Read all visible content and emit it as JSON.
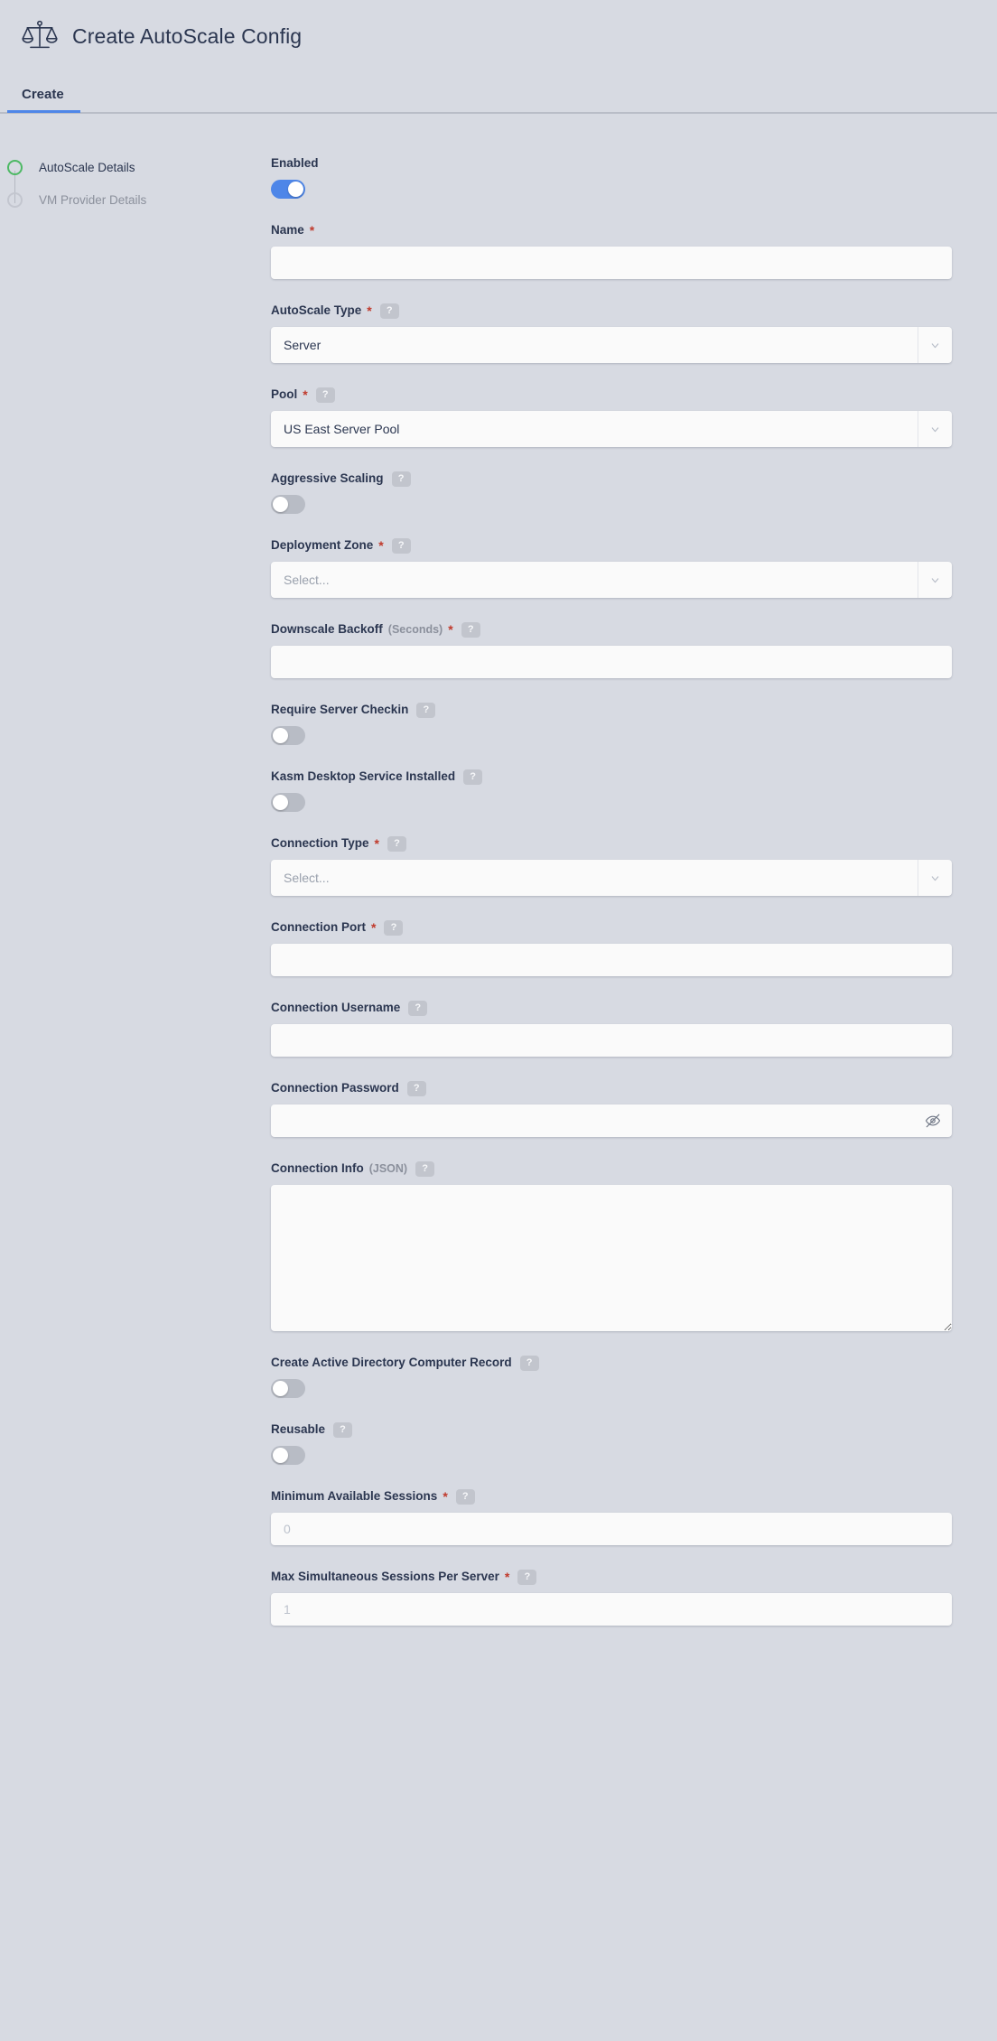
{
  "header": {
    "title": "Create AutoScale Config",
    "icon": "scale-balance-icon"
  },
  "tabs": [
    {
      "label": "Create",
      "active": true
    }
  ],
  "steps": [
    {
      "label": "AutoScale Details",
      "state": "active"
    },
    {
      "label": "VM Provider Details",
      "state": "pending"
    }
  ],
  "colors": {
    "page_background": "#d7dae2",
    "accent_blue": "#4e86e8",
    "step_active_green": "#4eb965",
    "label_text": "#2b3650",
    "required_red": "#c0392b",
    "help_badge": "#c2c5cd",
    "input_background": "#fafafa"
  },
  "fields": {
    "enabled": {
      "label": "Enabled",
      "type": "toggle",
      "value": true
    },
    "name": {
      "label": "Name",
      "required": true,
      "type": "text",
      "value": "",
      "placeholder": ""
    },
    "autoscale_type": {
      "label": "AutoScale Type",
      "required": true,
      "help": "?",
      "type": "select",
      "value": "Server"
    },
    "pool": {
      "label": "Pool",
      "required": true,
      "help": "?",
      "type": "select",
      "value": "US East Server Pool"
    },
    "aggressive_scaling": {
      "label": "Aggressive Scaling",
      "help": "?",
      "type": "toggle",
      "value": false
    },
    "deployment_zone": {
      "label": "Deployment Zone",
      "required": true,
      "help": "?",
      "type": "select",
      "value": "Select..."
    },
    "downscale_backoff": {
      "label": "Downscale Backoff",
      "sub": "(Seconds)",
      "required": true,
      "help": "?",
      "type": "text",
      "value": "",
      "placeholder": ""
    },
    "require_server_checkin": {
      "label": "Require Server Checkin",
      "help": "?",
      "type": "toggle",
      "value": false
    },
    "kasm_desktop_service": {
      "label": "Kasm Desktop Service Installed",
      "help": "?",
      "type": "toggle",
      "value": false
    },
    "connection_type": {
      "label": "Connection Type",
      "required": true,
      "help": "?",
      "type": "select",
      "value": "Select..."
    },
    "connection_port": {
      "label": "Connection Port",
      "required": true,
      "help": "?",
      "type": "text",
      "value": "",
      "placeholder": ""
    },
    "connection_username": {
      "label": "Connection Username",
      "help": "?",
      "type": "text",
      "value": "",
      "placeholder": ""
    },
    "connection_password": {
      "label": "Connection Password",
      "help": "?",
      "type": "password",
      "value": "",
      "placeholder": "",
      "reveal_icon": "eye-slash-icon"
    },
    "connection_info": {
      "label": "Connection Info",
      "sub": "(JSON)",
      "help": "?",
      "type": "textarea",
      "value": "",
      "placeholder": ""
    },
    "create_ad_computer_record": {
      "label": "Create Active Directory Computer Record",
      "help": "?",
      "type": "toggle",
      "value": false
    },
    "reusable": {
      "label": "Reusable",
      "help": "?",
      "type": "toggle",
      "value": false
    },
    "minimum_available_sessions": {
      "label": "Minimum Available Sessions",
      "required": true,
      "help": "?",
      "type": "text",
      "value": "",
      "placeholder": "0"
    },
    "max_simultaneous_sessions": {
      "label": "Max Simultaneous Sessions Per Server",
      "required": true,
      "help": "?",
      "type": "text",
      "value": "",
      "placeholder": "1"
    }
  }
}
